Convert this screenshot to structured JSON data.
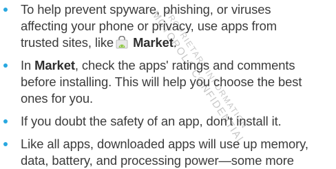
{
  "colors": {
    "bullet": "#29a8e0",
    "text": "#3b3b3b",
    "watermark": "#9a9a9a"
  },
  "watermark": {
    "line1": "MOTOROLA CONFIDENTIAL",
    "line2": "PROPRIETARY INFORMATION"
  },
  "tips": [
    {
      "line1": "To help prevent spyware, phishing, or viruses",
      "line2": "affecting your phone or privacy, use apps from",
      "line3_text": "trusted sites, like",
      "line3_icon": "market-bag-icon",
      "line3_bold": "Market",
      "line3_end": "."
    },
    {
      "line1_start": "In",
      "line1_bold": "Market",
      "line1_end": ", check the apps' ratings and comments",
      "line2": "before installing. This will help you choose the best",
      "line3": "ones for you."
    },
    {
      "line1": "If you doubt the safety of an app, don't install it."
    },
    {
      "line1": "Like all apps, downloaded apps will use up memory,",
      "line2": "data, battery, and processing power—some more"
    }
  ]
}
